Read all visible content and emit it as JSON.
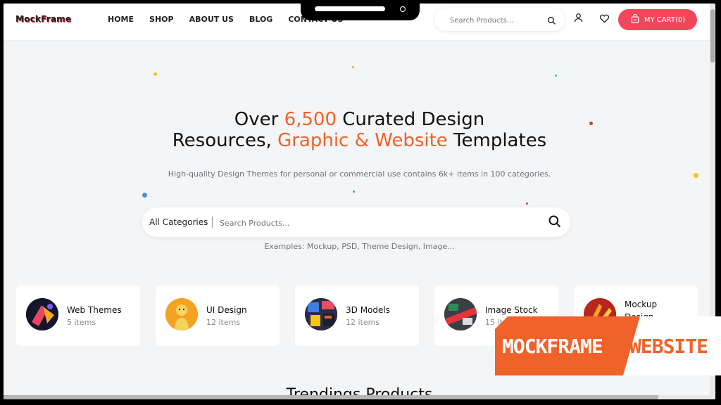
{
  "header": {
    "logo_text": "MockFrame",
    "nav": [
      "HOME",
      "SHOP",
      "ABOUT US",
      "BLOG",
      "CONTACT US"
    ],
    "search_placeholder": "Search Products...",
    "cart_label": "MY CART(0)"
  },
  "hero": {
    "title_part1": "Over ",
    "title_highlight1": "6,500",
    "title_part2": " Curated Design",
    "title_part3": "Resources, ",
    "title_highlight2": "Graphic & Website",
    "title_part4": " Templates",
    "subtitle": "High-quality Design Themes for personal or commercial use contains 6k+ items in 100 categories.",
    "category_select": "All Categories",
    "search_placeholder": "Search Products...",
    "examples": "Examples: Mockup, PSD, Theme Design, Image..."
  },
  "categories": [
    {
      "name": "Web Themes",
      "count": "5 items"
    },
    {
      "name": "UI Design",
      "count": "12 items"
    },
    {
      "name": "3D Models",
      "count": "12 items"
    },
    {
      "name": "Image Stock",
      "count": "15 items"
    },
    {
      "name": "Mockup Design",
      "count": ""
    }
  ],
  "trending": {
    "title": "Trendings Products"
  },
  "watermark": {
    "word1": "MOCKFRAME",
    "word2": "WEBSITE"
  },
  "colors": {
    "accent": "#f0622a",
    "cart": "#f2475b",
    "background": "#f4f5f7"
  },
  "icons": [
    "search-icon",
    "user-icon",
    "heart-icon",
    "cart-bag-icon"
  ]
}
